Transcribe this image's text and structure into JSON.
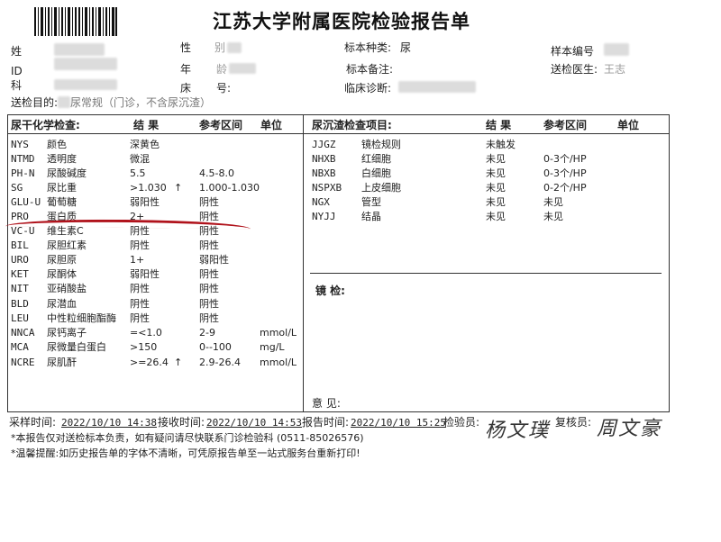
{
  "title": "江苏大学附属医院检验报告单",
  "header": {
    "name_label": "姓",
    "gender_label": "性",
    "gender_value_fragment": "别",
    "specimen_type_label": "标本种类:",
    "specimen_type_value": "尿",
    "sample_no_label": "样本编号",
    "id_label": "ID",
    "age_label": "年",
    "age_fragment": "龄",
    "specimen_note_label": "标本备注:",
    "sender_label": "送检医生:",
    "sender_fragment": "王志",
    "dept_label": "科",
    "bed_label": "床",
    "bed_fragment": "号:",
    "diagnosis_label": "临床诊断:",
    "test_item_label": "送检目的:",
    "test_item_value": "尿常规（门诊，不含尿沉渣）"
  },
  "left_table": {
    "title": "尿干化学检查:",
    "col_result": "结 果",
    "col_ref": "参考区间",
    "col_unit": "单位",
    "rows": [
      {
        "code": "NYS",
        "name": "颜色",
        "result": "深黄色",
        "flag": "",
        "ref": "",
        "unit": ""
      },
      {
        "code": "NTMD",
        "name": "透明度",
        "result": "微混",
        "flag": "",
        "ref": "",
        "unit": ""
      },
      {
        "code": "PH-N",
        "name": "尿酸碱度",
        "result": "5.5",
        "flag": "",
        "ref": "4.5-8.0",
        "unit": ""
      },
      {
        "code": "SG",
        "name": "尿比重",
        "result": ">1.030",
        "flag": "↑",
        "ref": "1.000-1.030",
        "unit": ""
      },
      {
        "code": "GLU-U",
        "name": "葡萄糖",
        "result": "弱阳性",
        "flag": "",
        "ref": "阴性",
        "unit": ""
      },
      {
        "code": "PRO",
        "name": "蛋白质",
        "result": "2+",
        "flag": "",
        "ref": "阴性",
        "unit": ""
      },
      {
        "code": "VC-U",
        "name": "维生素C",
        "result": "阴性",
        "flag": "",
        "ref": "阴性",
        "unit": ""
      },
      {
        "code": "BIL",
        "name": "尿胆红素",
        "result": "阴性",
        "flag": "",
        "ref": "阴性",
        "unit": ""
      },
      {
        "code": "URO",
        "name": "尿胆原",
        "result": "1+",
        "flag": "",
        "ref": "弱阳性",
        "unit": ""
      },
      {
        "code": "KET",
        "name": "尿酮体",
        "result": "弱阳性",
        "flag": "",
        "ref": "阴性",
        "unit": ""
      },
      {
        "code": "NIT",
        "name": "亚硝酸盐",
        "result": "阴性",
        "flag": "",
        "ref": "阴性",
        "unit": ""
      },
      {
        "code": "BLD",
        "name": "尿潜血",
        "result": "阴性",
        "flag": "",
        "ref": "阴性",
        "unit": ""
      },
      {
        "code": "LEU",
        "name": "中性粒细胞酯酶",
        "result": "阴性",
        "flag": "",
        "ref": "阴性",
        "unit": ""
      },
      {
        "code": "NNCA",
        "name": "尿钙离子",
        "result": "=<1.0",
        "flag": "",
        "ref": "2-9",
        "unit": "mmol/L"
      },
      {
        "code": "MCA",
        "name": "尿微量白蛋白",
        "result": ">150",
        "flag": "",
        "ref": "0--100",
        "unit": "mg/L"
      },
      {
        "code": "NCRE",
        "name": "尿肌酐",
        "result": ">=26.4",
        "flag": "↑",
        "ref": "2.9-26.4",
        "unit": "mmol/L"
      }
    ]
  },
  "right_table": {
    "title": "尿沉渣检查项目:",
    "col_result": "结 果",
    "col_ref": "参考区间",
    "col_unit": "单位",
    "rows": [
      {
        "code": "JJGZ",
        "name": "镜检规则",
        "result": "未触发",
        "ref": ""
      },
      {
        "code": "NHXB",
        "name": "红细胞",
        "result": "未见",
        "ref": "0-3个/HP"
      },
      {
        "code": "NBXB",
        "name": "白细胞",
        "result": "未见",
        "ref": "0-3个/HP"
      },
      {
        "code": "NSPXB",
        "name": "上皮细胞",
        "result": "未见",
        "ref": "0-2个/HP"
      },
      {
        "code": "NGX",
        "name": "管型",
        "result": "未见",
        "ref": "未见"
      },
      {
        "code": "NYJJ",
        "name": "结晶",
        "result": "未见",
        "ref": "未见"
      }
    ],
    "microscopy_label": "镜 检:",
    "opinion_label": "意 见:"
  },
  "footer": {
    "collect_label": "采样时间:",
    "collect_time": "2022/10/10 14:38",
    "receive_label": "接收时间:",
    "receive_time": "2022/10/10 14:53",
    "report_label": "报告时间:",
    "report_time": "2022/10/10 15:25",
    "tester_label": "检验员:",
    "tester_signature": "杨文璞",
    "reviewer_label": "复核员:",
    "reviewer_signature": "周文豪",
    "note1": "*本报告仅对送检标本负责，如有疑问请尽快联系门诊检验科 (0511-85026576)",
    "note2": "*温馨提醒:如历史报告单的字体不清晰，可凭原报告单至一站式服务台重新打印!"
  },
  "colors": {
    "red_underline": "#b0121b"
  }
}
